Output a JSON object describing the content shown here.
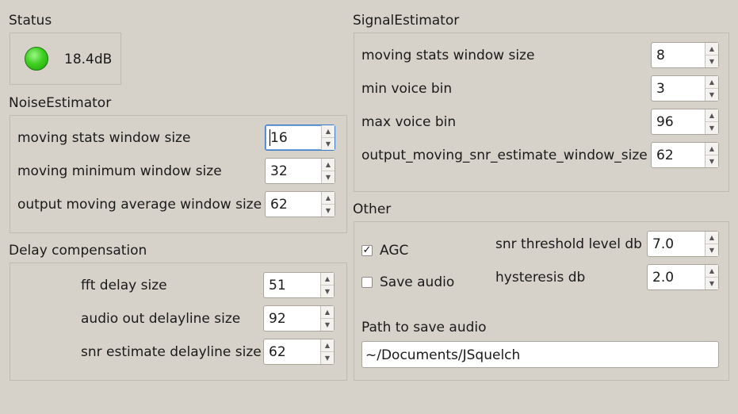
{
  "status": {
    "title": "Status",
    "value": "18.4dB",
    "indicator_color": "#3fd021"
  },
  "noise_estimator": {
    "title": "NoiseEstimator",
    "fields": [
      {
        "label": "moving stats window size",
        "value": "16"
      },
      {
        "label": "moving minimum window size",
        "value": "32"
      },
      {
        "label": "output moving average window size",
        "value": "62"
      }
    ]
  },
  "delay_compensation": {
    "title": "Delay compensation",
    "fields": [
      {
        "label": "fft delay size",
        "value": "51"
      },
      {
        "label": "audio out delayline size",
        "value": "92"
      },
      {
        "label": "snr estimate delayline size",
        "value": "62"
      }
    ]
  },
  "signal_estimator": {
    "title": "SignalEstimator",
    "fields": [
      {
        "label": "moving stats window size",
        "value": "8"
      },
      {
        "label": "min voice bin",
        "value": "3"
      },
      {
        "label": "max voice bin",
        "value": "96"
      },
      {
        "label": "output_moving_snr_estimate_window_size",
        "value": "62"
      }
    ]
  },
  "other": {
    "title": "Other",
    "agc": {
      "label": "AGC",
      "checked": true,
      "mark": "✓"
    },
    "save_audio": {
      "label": "Save audio",
      "checked": false
    },
    "snr_threshold": {
      "label": "snr threshold level db",
      "value": "7.0"
    },
    "hysteresis": {
      "label": "hysteresis db",
      "value": "2.0"
    },
    "path_label": "Path to save audio",
    "path_value": "~/Documents/JSquelch"
  },
  "icons": {
    "spin_up": "▲",
    "spin_down": "▼"
  }
}
